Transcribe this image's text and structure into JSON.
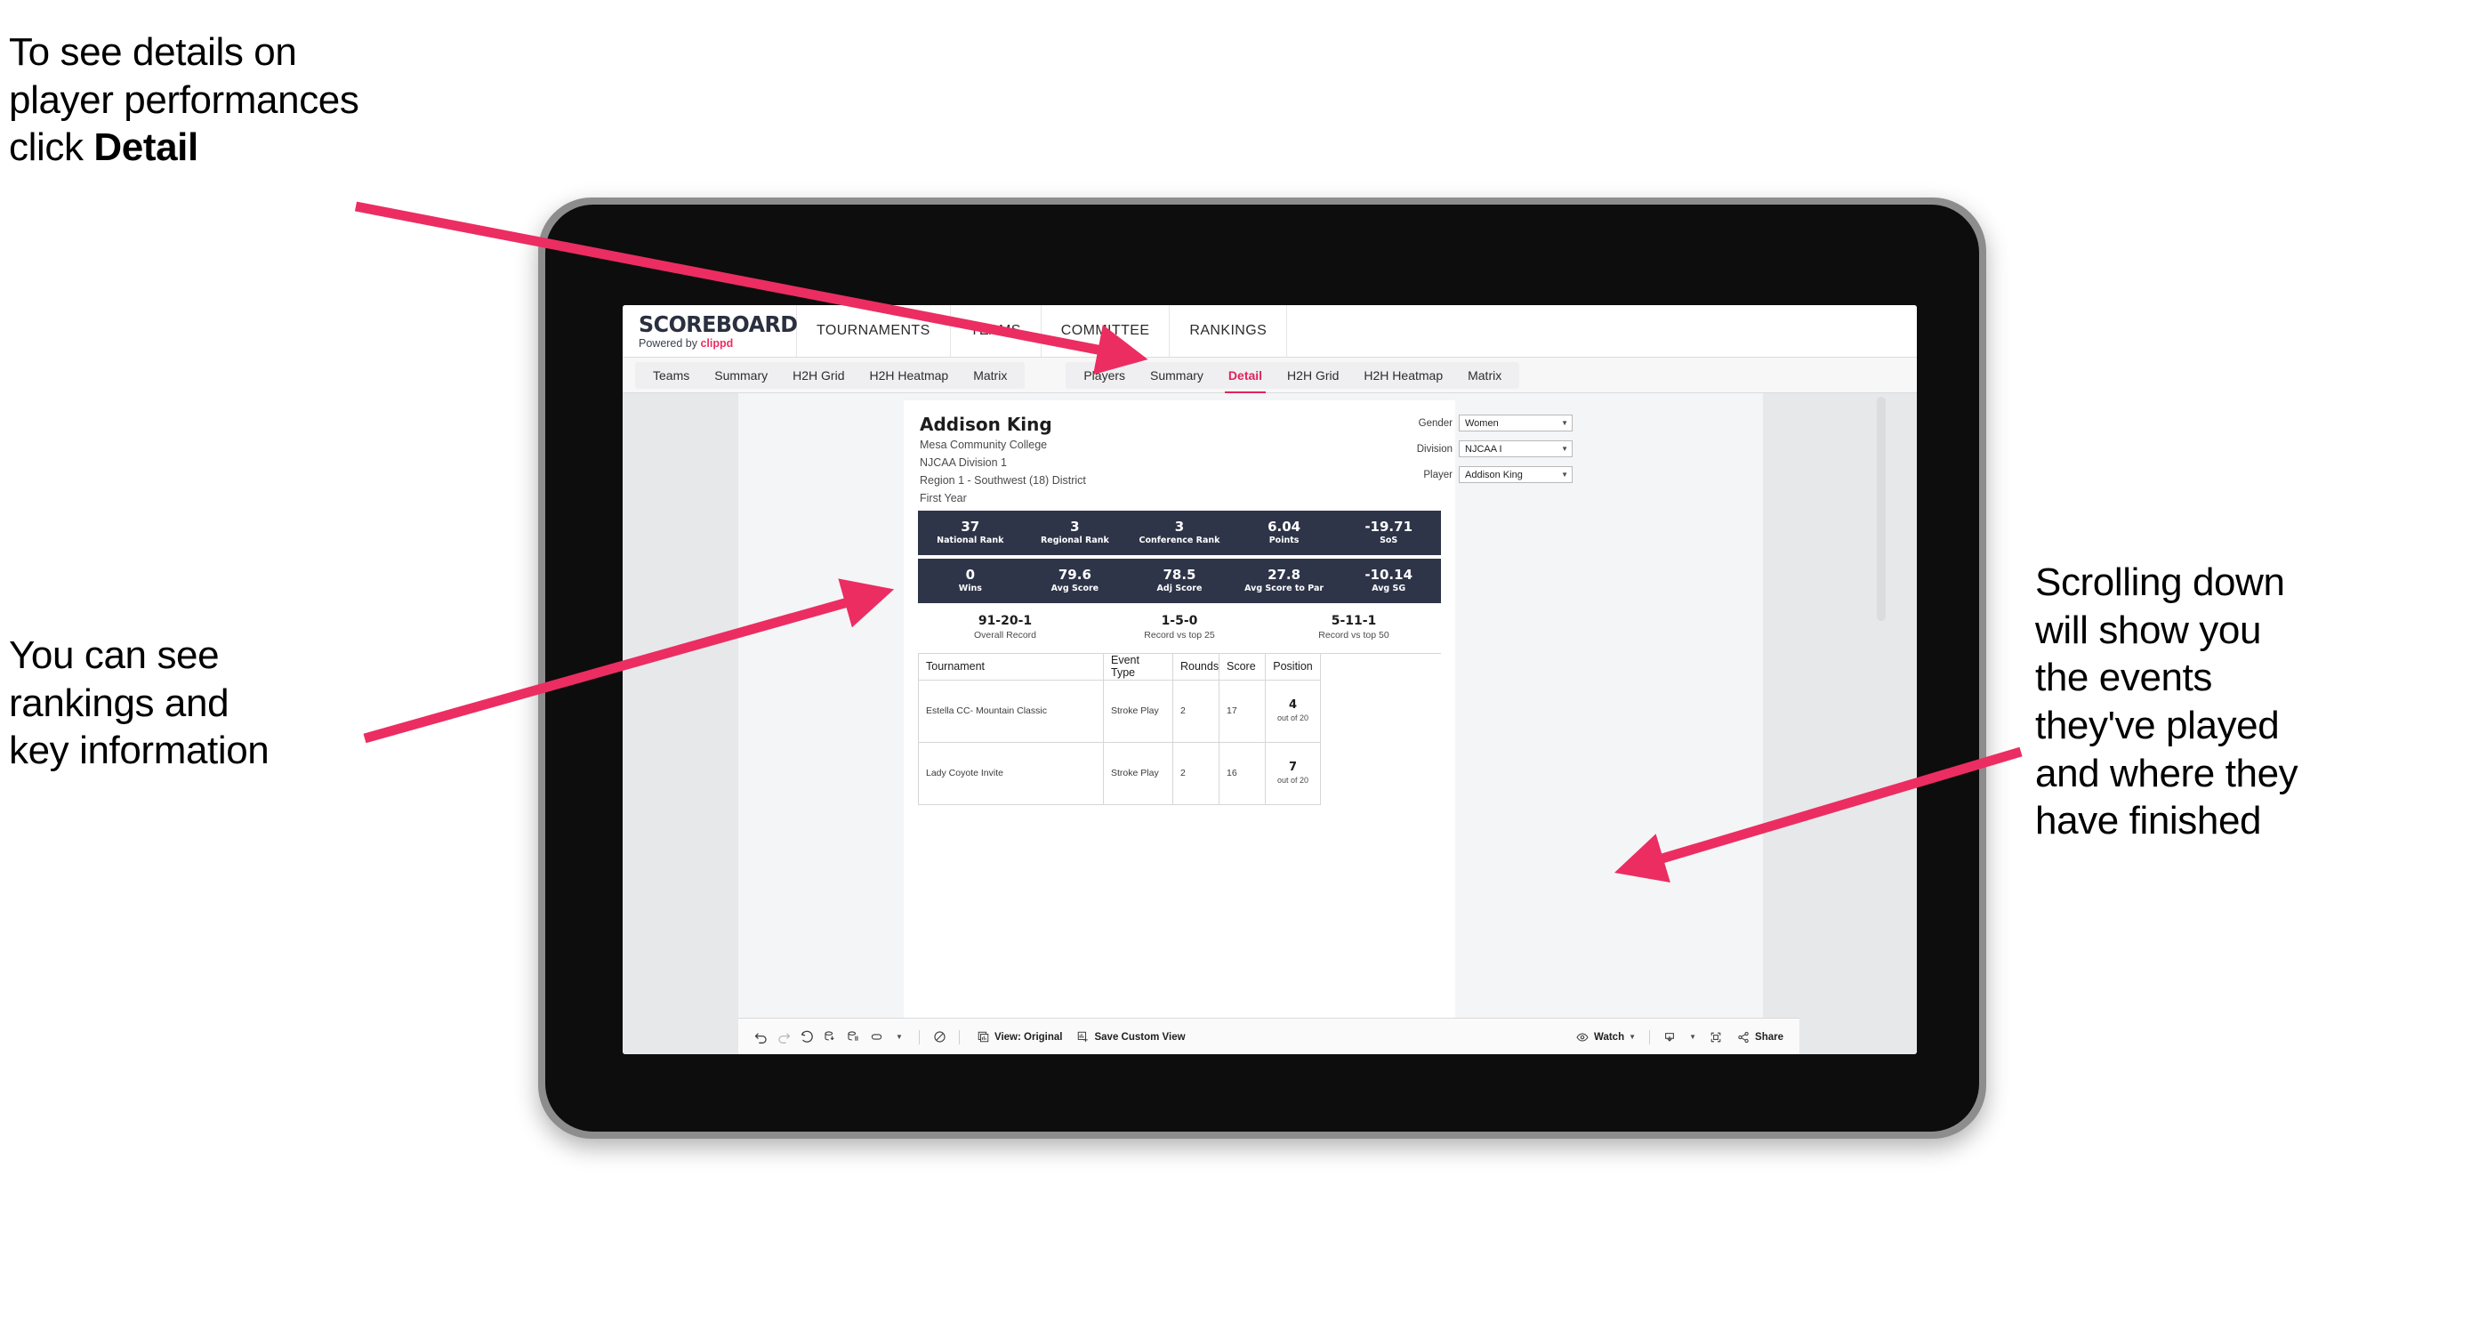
{
  "annotations": {
    "detail": "To see details on\nplayer performances\nclick ",
    "detail_bold": "Detail",
    "rankings": "You can see\nrankings and\nkey information",
    "scrolling": "Scrolling down\nwill show you\nthe events\nthey've played\nand where they\nhave finished"
  },
  "colors": {
    "accent_pink": "#ec2d62",
    "dark_navy": "#2e3549",
    "active_tab": "#e0245e"
  },
  "browser": {
    "brand": {
      "title": "SCOREBOARD",
      "powered_prefix": "Powered by ",
      "powered_name": "clippd"
    },
    "topnav": [
      {
        "label": "TOURNAMENTS"
      },
      {
        "label": "TEAMS"
      },
      {
        "label": "COMMITTEE"
      },
      {
        "label": "RANKINGS"
      }
    ],
    "subnav_teams": [
      {
        "label": "Teams"
      },
      {
        "label": "Summary"
      },
      {
        "label": "H2H Grid"
      },
      {
        "label": "H2H Heatmap"
      },
      {
        "label": "Matrix"
      }
    ],
    "subnav_players": [
      {
        "label": "Players"
      },
      {
        "label": "Summary"
      },
      {
        "label": "Detail"
      },
      {
        "label": "H2H Grid"
      },
      {
        "label": "H2H Heatmap"
      },
      {
        "label": "Matrix"
      }
    ]
  },
  "player": {
    "name": "Addison King",
    "school": "Mesa Community College",
    "division": "NJCAA Division 1",
    "region": "Region 1 - Southwest (18) District",
    "year": "First Year"
  },
  "filters": [
    {
      "label": "Gender",
      "value": "Women"
    },
    {
      "label": "Division",
      "value": "NJCAA I"
    },
    {
      "label": "Player",
      "value": "Addison King"
    }
  ],
  "stat_band_1": [
    {
      "value": "37",
      "label": "National Rank"
    },
    {
      "value": "3",
      "label": "Regional Rank"
    },
    {
      "value": "3",
      "label": "Conference Rank"
    },
    {
      "value": "6.04",
      "label": "Points"
    },
    {
      "value": "-19.71",
      "label": "SoS"
    }
  ],
  "stat_band_2": [
    {
      "value": "0",
      "label": "Wins"
    },
    {
      "value": "79.6",
      "label": "Avg Score"
    },
    {
      "value": "78.5",
      "label": "Adj Score"
    },
    {
      "value": "27.8",
      "label": "Avg Score to Par"
    },
    {
      "value": "-10.14",
      "label": "Avg SG"
    }
  ],
  "records": [
    {
      "value": "91-20-1",
      "label": "Overall Record"
    },
    {
      "value": "1-5-0",
      "label": "Record vs top 25"
    },
    {
      "value": "5-11-1",
      "label": "Record vs top 50"
    }
  ],
  "table": {
    "headers": [
      "Tournament",
      "Event Type",
      "Rounds",
      "Score",
      "Position"
    ],
    "rows": [
      {
        "tournament": "Estella CC- Mountain Classic",
        "event_type": "Stroke Play",
        "rounds": "2",
        "score": "17",
        "position": "4",
        "position_sub": "out of 20"
      },
      {
        "tournament": "Lady Coyote Invite",
        "event_type": "Stroke Play",
        "rounds": "2",
        "score": "16",
        "position": "7",
        "position_sub": "out of 20"
      }
    ]
  },
  "toolbar": {
    "view_label": "View: Original",
    "save_label": "Save Custom View",
    "watch_label": "Watch",
    "share_label": "Share"
  }
}
